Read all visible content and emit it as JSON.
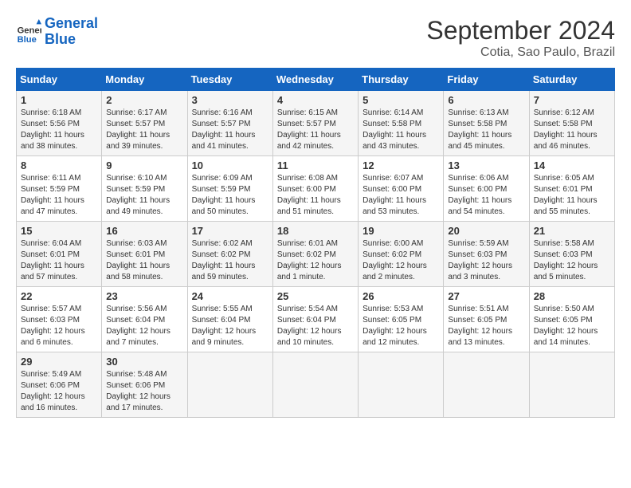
{
  "logo": {
    "line1": "General",
    "line2": "Blue"
  },
  "title": "September 2024",
  "subtitle": "Cotia, Sao Paulo, Brazil",
  "days_of_week": [
    "Sunday",
    "Monday",
    "Tuesday",
    "Wednesday",
    "Thursday",
    "Friday",
    "Saturday"
  ],
  "weeks": [
    [
      {
        "day": "1",
        "info": "Sunrise: 6:18 AM\nSunset: 5:56 PM\nDaylight: 11 hours\nand 38 minutes."
      },
      {
        "day": "2",
        "info": "Sunrise: 6:17 AM\nSunset: 5:57 PM\nDaylight: 11 hours\nand 39 minutes."
      },
      {
        "day": "3",
        "info": "Sunrise: 6:16 AM\nSunset: 5:57 PM\nDaylight: 11 hours\nand 41 minutes."
      },
      {
        "day": "4",
        "info": "Sunrise: 6:15 AM\nSunset: 5:57 PM\nDaylight: 11 hours\nand 42 minutes."
      },
      {
        "day": "5",
        "info": "Sunrise: 6:14 AM\nSunset: 5:58 PM\nDaylight: 11 hours\nand 43 minutes."
      },
      {
        "day": "6",
        "info": "Sunrise: 6:13 AM\nSunset: 5:58 PM\nDaylight: 11 hours\nand 45 minutes."
      },
      {
        "day": "7",
        "info": "Sunrise: 6:12 AM\nSunset: 5:58 PM\nDaylight: 11 hours\nand 46 minutes."
      }
    ],
    [
      {
        "day": "8",
        "info": "Sunrise: 6:11 AM\nSunset: 5:59 PM\nDaylight: 11 hours\nand 47 minutes."
      },
      {
        "day": "9",
        "info": "Sunrise: 6:10 AM\nSunset: 5:59 PM\nDaylight: 11 hours\nand 49 minutes."
      },
      {
        "day": "10",
        "info": "Sunrise: 6:09 AM\nSunset: 5:59 PM\nDaylight: 11 hours\nand 50 minutes."
      },
      {
        "day": "11",
        "info": "Sunrise: 6:08 AM\nSunset: 6:00 PM\nDaylight: 11 hours\nand 51 minutes."
      },
      {
        "day": "12",
        "info": "Sunrise: 6:07 AM\nSunset: 6:00 PM\nDaylight: 11 hours\nand 53 minutes."
      },
      {
        "day": "13",
        "info": "Sunrise: 6:06 AM\nSunset: 6:00 PM\nDaylight: 11 hours\nand 54 minutes."
      },
      {
        "day": "14",
        "info": "Sunrise: 6:05 AM\nSunset: 6:01 PM\nDaylight: 11 hours\nand 55 minutes."
      }
    ],
    [
      {
        "day": "15",
        "info": "Sunrise: 6:04 AM\nSunset: 6:01 PM\nDaylight: 11 hours\nand 57 minutes."
      },
      {
        "day": "16",
        "info": "Sunrise: 6:03 AM\nSunset: 6:01 PM\nDaylight: 11 hours\nand 58 minutes."
      },
      {
        "day": "17",
        "info": "Sunrise: 6:02 AM\nSunset: 6:02 PM\nDaylight: 11 hours\nand 59 minutes."
      },
      {
        "day": "18",
        "info": "Sunrise: 6:01 AM\nSunset: 6:02 PM\nDaylight: 12 hours\nand 1 minute."
      },
      {
        "day": "19",
        "info": "Sunrise: 6:00 AM\nSunset: 6:02 PM\nDaylight: 12 hours\nand 2 minutes."
      },
      {
        "day": "20",
        "info": "Sunrise: 5:59 AM\nSunset: 6:03 PM\nDaylight: 12 hours\nand 3 minutes."
      },
      {
        "day": "21",
        "info": "Sunrise: 5:58 AM\nSunset: 6:03 PM\nDaylight: 12 hours\nand 5 minutes."
      }
    ],
    [
      {
        "day": "22",
        "info": "Sunrise: 5:57 AM\nSunset: 6:03 PM\nDaylight: 12 hours\nand 6 minutes."
      },
      {
        "day": "23",
        "info": "Sunrise: 5:56 AM\nSunset: 6:04 PM\nDaylight: 12 hours\nand 7 minutes."
      },
      {
        "day": "24",
        "info": "Sunrise: 5:55 AM\nSunset: 6:04 PM\nDaylight: 12 hours\nand 9 minutes."
      },
      {
        "day": "25",
        "info": "Sunrise: 5:54 AM\nSunset: 6:04 PM\nDaylight: 12 hours\nand 10 minutes."
      },
      {
        "day": "26",
        "info": "Sunrise: 5:53 AM\nSunset: 6:05 PM\nDaylight: 12 hours\nand 12 minutes."
      },
      {
        "day": "27",
        "info": "Sunrise: 5:51 AM\nSunset: 6:05 PM\nDaylight: 12 hours\nand 13 minutes."
      },
      {
        "day": "28",
        "info": "Sunrise: 5:50 AM\nSunset: 6:05 PM\nDaylight: 12 hours\nand 14 minutes."
      }
    ],
    [
      {
        "day": "29",
        "info": "Sunrise: 5:49 AM\nSunset: 6:06 PM\nDaylight: 12 hours\nand 16 minutes."
      },
      {
        "day": "30",
        "info": "Sunrise: 5:48 AM\nSunset: 6:06 PM\nDaylight: 12 hours\nand 17 minutes."
      },
      {
        "day": "",
        "info": ""
      },
      {
        "day": "",
        "info": ""
      },
      {
        "day": "",
        "info": ""
      },
      {
        "day": "",
        "info": ""
      },
      {
        "day": "",
        "info": ""
      }
    ]
  ]
}
